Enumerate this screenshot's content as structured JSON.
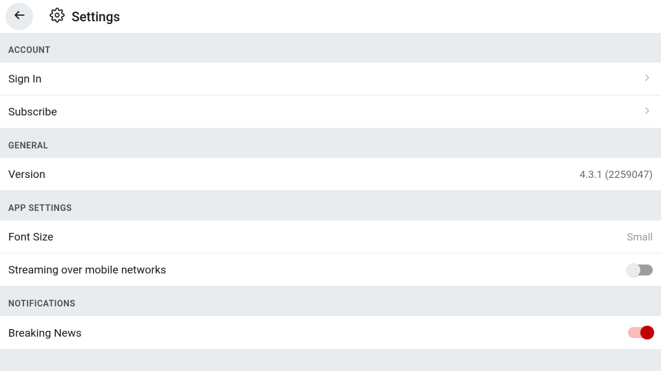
{
  "header": {
    "title": "Settings"
  },
  "sections": {
    "account": {
      "header": "ACCOUNT",
      "sign_in": "Sign In",
      "subscribe": "Subscribe"
    },
    "general": {
      "header": "GENERAL",
      "version_label": "Version",
      "version_value": "4.3.1 (2259047)"
    },
    "app_settings": {
      "header": "APP SETTINGS",
      "font_size_label": "Font Size",
      "font_size_value": "Small",
      "streaming_label": "Streaming over mobile networks",
      "streaming_enabled": false
    },
    "notifications": {
      "header": "NOTIFICATIONS",
      "breaking_news_label": "Breaking News",
      "breaking_news_enabled": true
    }
  }
}
